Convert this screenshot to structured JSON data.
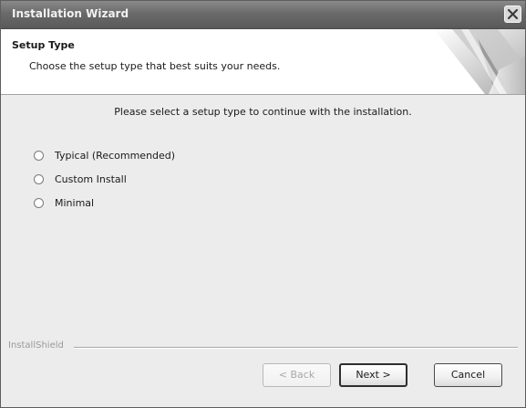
{
  "window": {
    "title": "Installation Wizard",
    "close_icon": "close-icon",
    "close_color": "#e8e8e8"
  },
  "header": {
    "title": "Setup Type",
    "subtitle": "Choose the setup type that best suits your needs."
  },
  "prompt": "Please select a setup type to continue with the installation.",
  "options": [
    {
      "label": "Typical (Recommended)",
      "selected": false
    },
    {
      "label": "Custom Install",
      "selected": false
    },
    {
      "label": "Minimal",
      "selected": false
    }
  ],
  "footer": {
    "brand_label": "InstallShield",
    "back_label": "< Back",
    "next_label": "Next >",
    "cancel_label": "Cancel"
  }
}
